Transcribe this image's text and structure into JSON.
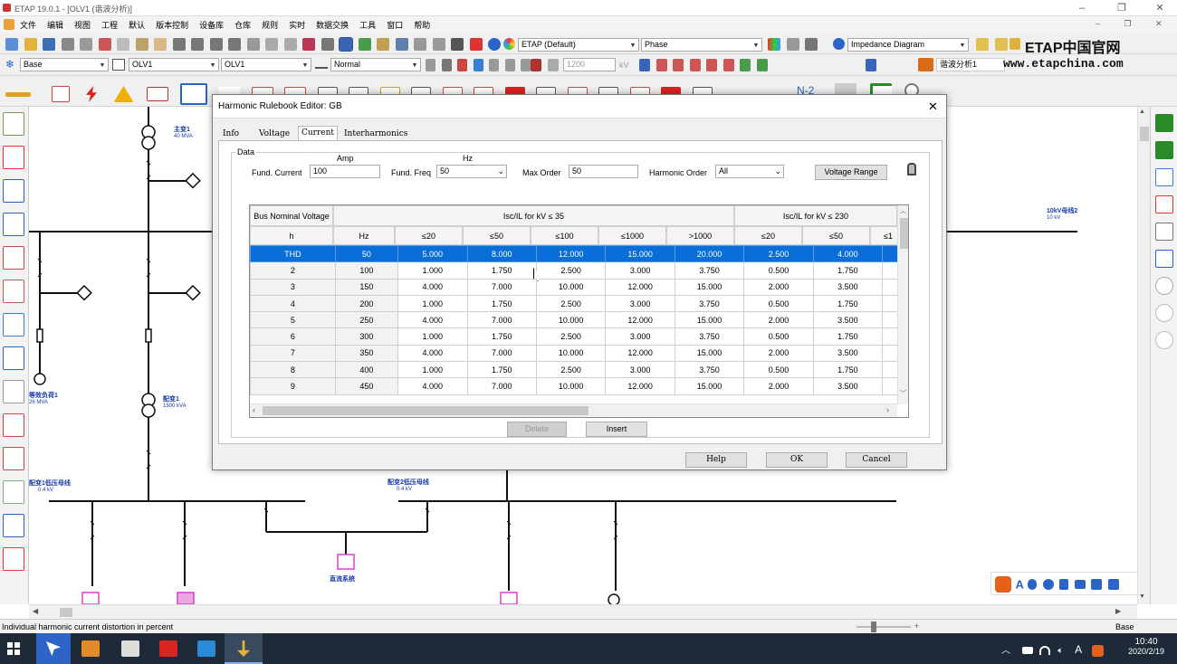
{
  "window": {
    "title": "ETAP 19.0.1 - [OLV1 (谐波分析)]"
  },
  "menu": [
    "文件",
    "编辑",
    "视图",
    "工程",
    "默认",
    "版本控制",
    "设备库",
    "仓库",
    "规则",
    "实时",
    "数据交换",
    "工具",
    "窗口",
    "帮助"
  ],
  "toolbar1": {
    "library_combo": "ETAP (Default)",
    "phase_combo": "Phase",
    "diagram_combo": "Impedance Diagram",
    "watermark_title": "ETAP中国官网",
    "watermark_url": "www.etapchina.com"
  },
  "toolbar2": {
    "base_combo": "Base",
    "olv_combo1": "OLV1",
    "olv_combo2": "OLV1",
    "mode_combo": "Normal",
    "voltage_value": "1200",
    "voltage_unit": "kV",
    "study_case": "谐波分析1"
  },
  "toolbar3": {
    "n2_label": "N-2"
  },
  "canvas": {
    "labels": [
      {
        "text": "主变1",
        "sub": "40 MVA"
      },
      {
        "text": "10kV母线2",
        "sub": "10 kV"
      },
      {
        "text": "等效负荷1",
        "sub": "26 MVA"
      },
      {
        "text": "配变1",
        "sub": "1500 kVA"
      },
      {
        "text": "配变1低压母线",
        "sub": "0.4 kV"
      },
      {
        "text": "配变2低压母线",
        "sub": "0.4 kV"
      },
      {
        "text": "直流系统",
        "sub": ""
      }
    ]
  },
  "dialog": {
    "title": "Harmonic Rulebook Editor: GB",
    "tabs": [
      "Info",
      "Voltage",
      "Current",
      "Interharmonics"
    ],
    "active_tab": "Current",
    "group_label": "Data",
    "amp_label": "Amp",
    "hz_label": "Hz",
    "fund_current_label": "Fund. Current",
    "fund_current_value": "100",
    "fund_freq_label": "Fund. Freq",
    "fund_freq_value": "50",
    "max_order_label": "Max Order",
    "max_order_value": "50",
    "harmonic_order_label": "Harmonic Order",
    "harmonic_order_value": "All",
    "voltage_range_button": "Voltage Range",
    "table": {
      "group_header_col": "Bus Nominal Voltage (Un; kV)",
      "group_header_35": "Isc/IL for kV ≤ 35",
      "group_header_230": "Isc/IL for kV ≤ 230",
      "columns": [
        "h",
        "Hz",
        "≤20",
        "≤50",
        "≤100",
        "≤1000",
        ">1000",
        "≤20",
        "≤50",
        "≤1"
      ],
      "rows": [
        [
          "THD",
          "50",
          "5.000",
          "8.000",
          "12.000",
          "15.000",
          "20.000",
          "2.500",
          "4.000",
          "6"
        ],
        [
          "2",
          "100",
          "1.000",
          "1.750",
          "2.500",
          "3.000",
          "3.750",
          "0.500",
          "1.750",
          "1"
        ],
        [
          "3",
          "150",
          "4.000",
          "7.000",
          "10.000",
          "12.000",
          "15.000",
          "2.000",
          "3.500",
          "5"
        ],
        [
          "4",
          "200",
          "1.000",
          "1.750",
          "2.500",
          "3.000",
          "3.750",
          "0.500",
          "1.750",
          "1"
        ],
        [
          "5",
          "250",
          "4.000",
          "7.000",
          "10.000",
          "12.000",
          "15.000",
          "2.000",
          "3.500",
          "5"
        ],
        [
          "6",
          "300",
          "1.000",
          "1.750",
          "2.500",
          "3.000",
          "3.750",
          "0.500",
          "1.750",
          "1"
        ],
        [
          "7",
          "350",
          "4.000",
          "7.000",
          "10.000",
          "12.000",
          "15.000",
          "2.000",
          "3.500",
          "5"
        ],
        [
          "8",
          "400",
          "1.000",
          "1.750",
          "2.500",
          "3.000",
          "3.750",
          "0.500",
          "1.750",
          "1"
        ],
        [
          "9",
          "450",
          "4.000",
          "7.000",
          "10.000",
          "12.000",
          "15.000",
          "2.000",
          "3.500",
          "5"
        ]
      ]
    },
    "delete_button": "Delete",
    "insert_button": "Insert",
    "help_button": "Help",
    "ok_button": "OK",
    "cancel_button": "Cancel"
  },
  "statusbar": {
    "text": "Individual harmonic current distortion in percent",
    "right": "Base"
  },
  "taskbar": {
    "time": "10:40",
    "date": "2020/2/19",
    "ime": "A"
  }
}
